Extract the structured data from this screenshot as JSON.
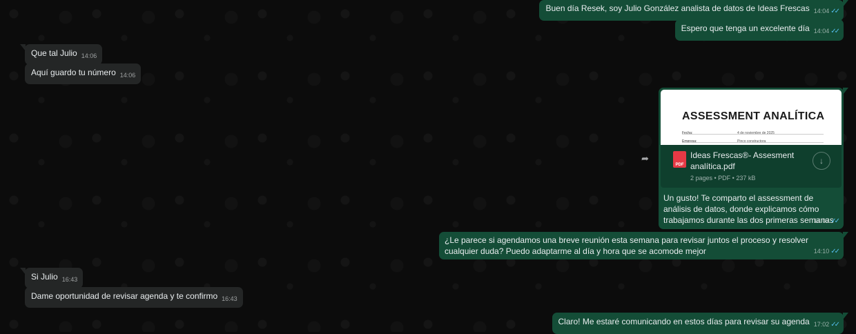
{
  "messages": [
    {
      "id": "m1",
      "dir": "out",
      "text": "Buen día Resek, soy Julio González analista de datos de Ideas Frescas",
      "time": "14:04"
    },
    {
      "id": "m2",
      "dir": "out",
      "text": "Espero que tenga un excelente día",
      "time": "14:04"
    },
    {
      "id": "m3",
      "dir": "in",
      "text": "Que tal Julio",
      "time": "14:06"
    },
    {
      "id": "m4",
      "dir": "in",
      "text": "Aquí guardo tu número",
      "time": "14:06"
    },
    {
      "id": "m6",
      "dir": "out",
      "text": "¿Le parece si agendamos una breve reunión esta semana para revisar juntos el proceso y resolver cualquier duda? Puedo adaptarme al día y hora que se acomode mejor",
      "time": "14:10"
    },
    {
      "id": "m7",
      "dir": "in",
      "text": "Si Julio",
      "time": "16:43"
    },
    {
      "id": "m8",
      "dir": "in",
      "text": "Dame oportunidad de revisar agenda y te confirmo",
      "time": "16:43"
    },
    {
      "id": "m9",
      "dir": "out",
      "text": "Claro! Me estaré comunicando en estos días para revisar su agenda",
      "time": "17:02"
    }
  ],
  "document": {
    "preview_title": "ASSESSMENT ANALÍTICA",
    "preview_rows": [
      {
        "label": "Fecha:",
        "value": "4 de noviembre de 2025"
      },
      {
        "label": "Empresa:",
        "value": "Pinco constructora"
      }
    ],
    "file_icon": "PDF",
    "file_name": "Ideas Frescas®- Assesment analítica.pdf",
    "file_info": "2 pages • PDF • 237 kB",
    "caption": "Un gusto! Te comparto el assessment de análisis de datos, donde explicamos cómo trabajamos durante las dos primeras semanas",
    "time": "14:07"
  },
  "icons": {
    "read": "double-check-icon",
    "forward": "forward-icon",
    "download": "download-icon"
  },
  "colors": {
    "outgoing": "#144d37",
    "incoming": "#242626",
    "read_check": "#53bdeb",
    "pdf": "#e53945"
  }
}
